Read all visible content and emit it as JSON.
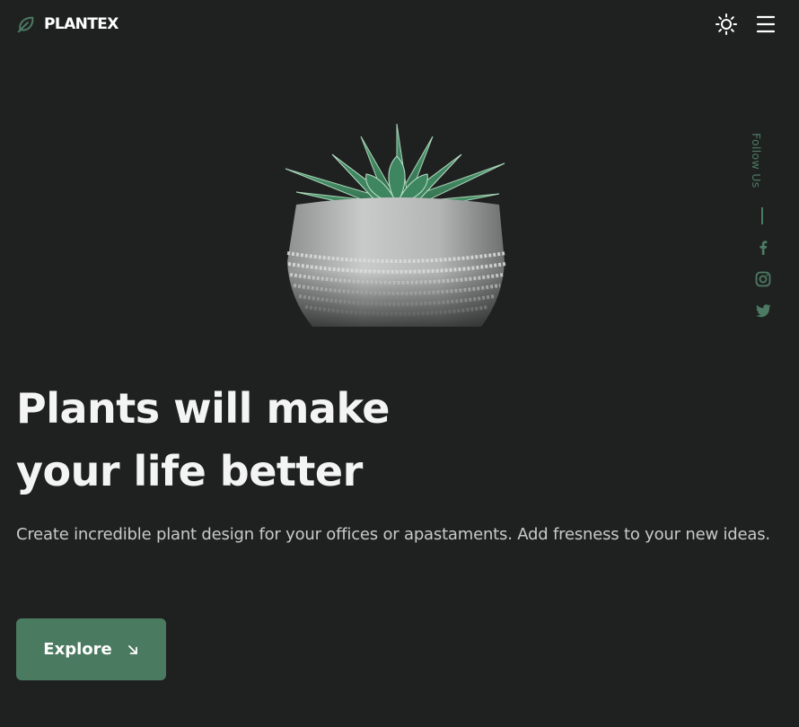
{
  "header": {
    "brand": "PLANTEX",
    "logo_icon": "leaf-icon",
    "theme_icon": "sun-icon",
    "menu_icon": "hamburger-menu-icon"
  },
  "hero": {
    "image": "succulent-in-concrete-pot",
    "headline_line1": "Plants will make",
    "headline_line2": "your life better",
    "description": "Create incredible plant design for your offices or apastaments. Add fresness to your new ideas.",
    "cta_label": "Explore",
    "cta_icon": "arrow-down-right-icon"
  },
  "social": {
    "label": "Follow Us",
    "links": [
      "facebook-icon",
      "instagram-icon",
      "twitter-icon"
    ]
  },
  "colors": {
    "background": "#1f2121",
    "accent": "#4a7a5f",
    "accent_text": "#4d7a63"
  }
}
